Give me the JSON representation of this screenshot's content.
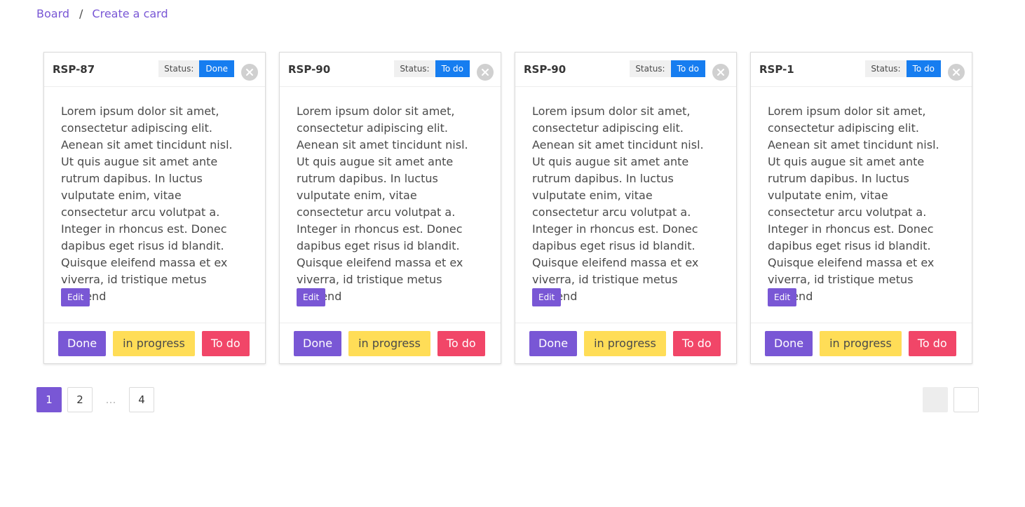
{
  "breadcrumb": {
    "items": [
      {
        "label": "Board"
      },
      {
        "label": "Create a card"
      }
    ],
    "separator": "/"
  },
  "colors": {
    "primary": "#7957d5",
    "info": "#167df0",
    "warning": "#ffdd57",
    "danger": "#f14668"
  },
  "cards": [
    {
      "title": "RSP-87",
      "status_label": "Status:",
      "status": "Done",
      "body": "Lorem ipsum dolor sit amet, consectetur adipiscing elit. Aenean sit amet tincidunt nisl. Ut quis augue sit amet ante rutrum dapibus. In luctus vulputate enim, vitae consectetur arcu volutpat a. Integer in rhoncus est. Donec dapibus eget risus id blandit. Quisque eleifend massa et ex viverra, id tristique metus eleifend",
      "edit_label": "Edit",
      "done_label": "Done",
      "progress_label": "in progress",
      "todo_label": "To do"
    },
    {
      "title": "RSP-90",
      "status_label": "Status:",
      "status": "To do",
      "body": "Lorem ipsum dolor sit amet, consectetur adipiscing elit. Aenean sit amet tincidunt nisl. Ut quis augue sit amet ante rutrum dapibus. In luctus vulputate enim, vitae consectetur arcu volutpat a. Integer in rhoncus est. Donec dapibus eget risus id blandit. Quisque eleifend massa et ex viverra, id tristique metus eleifend",
      "edit_label": "Edit",
      "done_label": "Done",
      "progress_label": "in progress",
      "todo_label": "To do"
    },
    {
      "title": "RSP-90",
      "status_label": "Status:",
      "status": "To do",
      "body": "Lorem ipsum dolor sit amet, consectetur adipiscing elit. Aenean sit amet tincidunt nisl. Ut quis augue sit amet ante rutrum dapibus. In luctus vulputate enim, vitae consectetur arcu volutpat a. Integer in rhoncus est. Donec dapibus eget risus id blandit. Quisque eleifend massa et ex viverra, id tristique metus eleifend",
      "edit_label": "Edit",
      "done_label": "Done",
      "progress_label": "in progress",
      "todo_label": "To do"
    },
    {
      "title": "RSP-1",
      "status_label": "Status:",
      "status": "To do",
      "body": "Lorem ipsum dolor sit amet, consectetur adipiscing elit. Aenean sit amet tincidunt nisl. Ut quis augue sit amet ante rutrum dapibus. In luctus vulputate enim, vitae consectetur arcu volutpat a. Integer in rhoncus est. Donec dapibus eget risus id blandit. Quisque eleifend massa et ex viverra, id tristique metus eleifend",
      "edit_label": "Edit",
      "done_label": "Done",
      "progress_label": "in progress",
      "todo_label": "To do"
    }
  ],
  "pagination": {
    "pages": [
      "1",
      "2",
      "4"
    ],
    "current": "1",
    "ellipsis": "…"
  }
}
